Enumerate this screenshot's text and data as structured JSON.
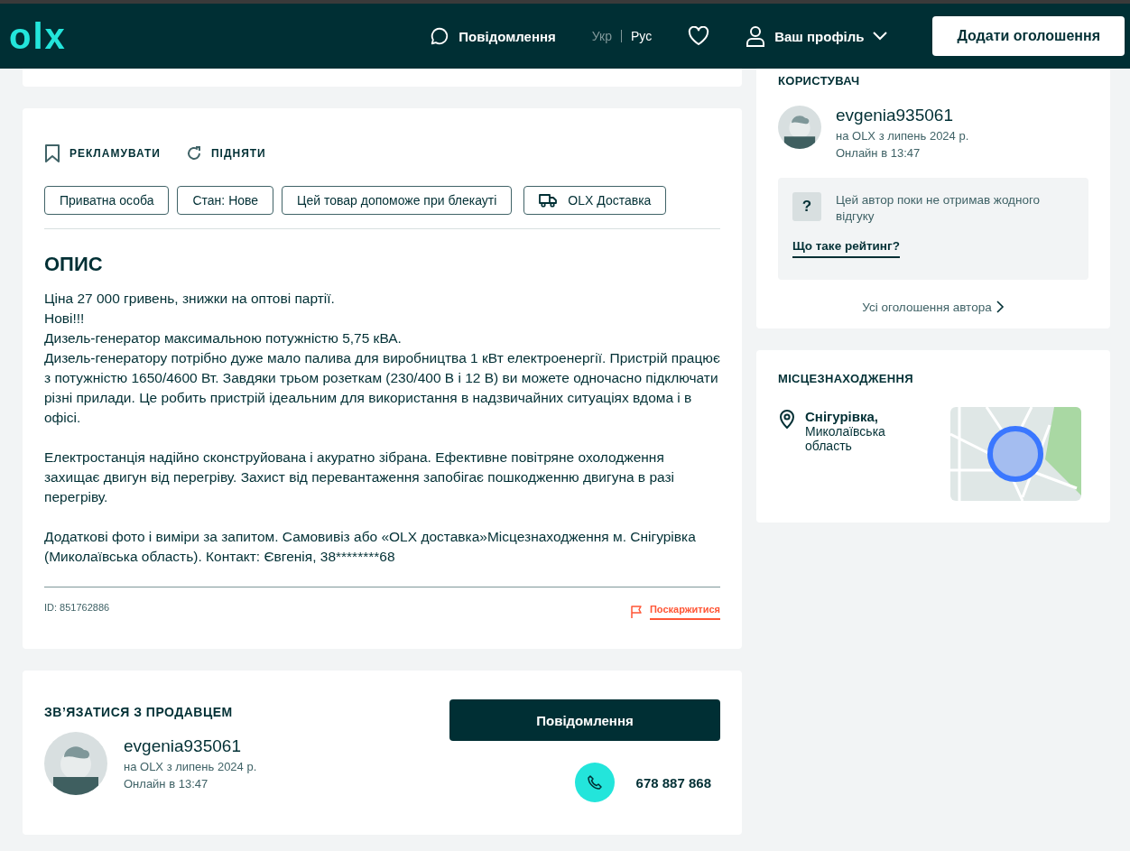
{
  "header": {
    "logo": "olx",
    "messages": "Повідомлення",
    "languages": [
      {
        "label": "Укр",
        "selected": true
      },
      {
        "label": "Рус",
        "selected": false
      }
    ],
    "profile": "Ваш профіль",
    "add_button": "Додати оголошення"
  },
  "ad": {
    "actions": [
      "РЕКЛАМУВАТИ",
      "ПІДНЯТИ"
    ],
    "tags": [
      {
        "label": "Приватна особа",
        "kind": "plain"
      },
      {
        "label": "Стан: Нове",
        "kind": "plain"
      },
      {
        "label": "Цей товар допоможе при блекауті",
        "kind": "plain"
      },
      {
        "label": "OLX Доставка",
        "kind": "delivery"
      }
    ],
    "description_title": "ОПИС",
    "description": [
      [
        "Ціна 27 000 гривень, знижки на оптові партії.",
        "Нові!!!",
        "Дизель-генератор максимальною потужністю 5,75 кВА.",
        "Дизель-генератору потрібно дуже мало палива для виробництва 1 кВт електроенергії. Пристрій працює з потужністю 1650/4600 Вт. Завдяки трьом розеткам (230/400 В і 12 В) ви можете одночасно підключати різні прилади. Це робить пристрій ідеальним для використання в надзвичайних ситуаціях вдома і в офісі."
      ],
      [
        "Електростанція надійно сконструйована і акуратно зібрана. Ефективне повітряне охолодження захищає двигун від перегріву. Захист від перевантаження запобігає пошкодженню двигуна в разі перегріву."
      ],
      [
        "Додаткові фото і виміри за запитом. Самовивіз або «OLX доставка»Місцезнаходження м. Снігурівка (Миколаївська область). Контакт: Євгенія, 38********68"
      ]
    ],
    "id": "ID: 851762886",
    "report": "Поскаржитися"
  },
  "contact": {
    "title": "ЗВ’ЯЗАТИСЯ З ПРОДАВЦЕМ",
    "user": "evgenia935061",
    "since": "на OLX з липень 2024 р.",
    "online": "Онлайн в 13:47",
    "message_button": "Повідомлення",
    "phone": "678 887 868"
  },
  "user_card": {
    "title": "КОРИСТУВАЧ",
    "user": "evgenia935061",
    "since": "на OLX з липень 2024 р.",
    "online": "Онлайн в 13:47",
    "rating_icon": "?",
    "rating_text": "Цей автор поки не отримав жодного відгуку",
    "rating_link": "Що таке рейтинг?",
    "all_ads": "Усі оголошення автора"
  },
  "location": {
    "title": "МІСЦЕЗНАХОДЖЕННЯ",
    "city": "Снігурівка,",
    "region": "Миколаївська область"
  }
}
